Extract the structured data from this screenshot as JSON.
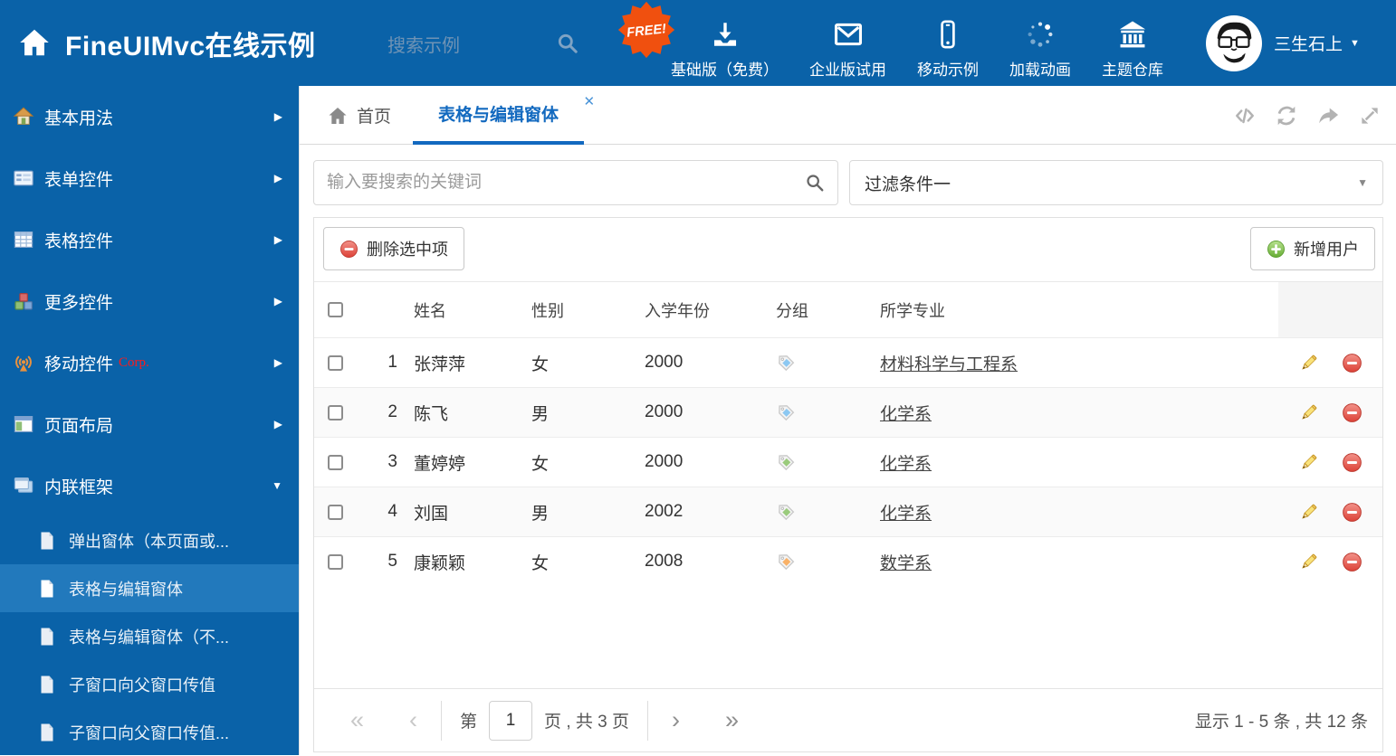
{
  "colors": {
    "header_bg": "#0A62A8",
    "sidebar_selected_bg": "#2279BC",
    "accent_blue": "#1269BF",
    "free_badge_bg": "#F0500F",
    "link_color": "#444444",
    "delete_red": "#DD4238",
    "add_green": "#66AC34",
    "pencil_yellow": "#F9E27A"
  },
  "icons": {
    "caret_down": "▼",
    "arrow_right": "▶",
    "arrow_down": "▼",
    "close": "✕",
    "chevron_double_left": "«",
    "chevron_left": "‹",
    "chevron_right": "›",
    "chevron_double_right": "»"
  },
  "header": {
    "title": "FineUIMvc在线示例",
    "search_placeholder": "搜索示例",
    "free_badge": "FREE!",
    "menu": [
      {
        "label": "基础版（免费）",
        "icon": "download-icon"
      },
      {
        "label": "企业版试用",
        "icon": "envelope-icon"
      },
      {
        "label": "移动示例",
        "icon": "mobile-icon"
      },
      {
        "label": "加载动画",
        "icon": "spinner-icon"
      },
      {
        "label": "主题仓库",
        "icon": "bank-icon"
      }
    ],
    "user_name": "三生石上"
  },
  "sidebar": {
    "items": [
      {
        "label": "基本用法",
        "icon": "home-icon"
      },
      {
        "label": "表单控件",
        "icon": "form-icon"
      },
      {
        "label": "表格控件",
        "icon": "grid-icon"
      },
      {
        "label": "更多控件",
        "icon": "cubes-icon"
      },
      {
        "label": "移动控件",
        "badge": "Corp.",
        "icon": "antenna-icon"
      },
      {
        "label": "页面布局",
        "icon": "layout-icon"
      },
      {
        "label": "内联框架",
        "icon": "frames-icon",
        "expanded": true
      }
    ],
    "subitems": [
      {
        "label": "弹出窗体（本页面或..."
      },
      {
        "label": "表格与编辑窗体",
        "selected": true
      },
      {
        "label": "表格与编辑窗体（不..."
      },
      {
        "label": "子窗口向父窗口传值"
      },
      {
        "label": "子窗口向父窗口传值..."
      }
    ]
  },
  "tabs": {
    "home": "首页",
    "active": "表格与编辑窗体"
  },
  "content": {
    "search_placeholder": "输入要搜索的关键词",
    "filter_value": "过滤条件一",
    "delete_button": "删除选中项",
    "add_button": "新增用户",
    "table": {
      "columns": [
        "姓名",
        "性别",
        "入学年份",
        "分组",
        "所学专业"
      ],
      "rows": [
        {
          "index": "1",
          "name": "张萍萍",
          "gender": "女",
          "year": "2000",
          "tag_color": "#8CC8F2",
          "major": "材料科学与工程系"
        },
        {
          "index": "2",
          "name": "陈飞",
          "gender": "男",
          "year": "2000",
          "tag_color": "#8CC8F2",
          "major": "化学系"
        },
        {
          "index": "3",
          "name": "董婷婷",
          "gender": "女",
          "year": "2000",
          "tag_color": "#9ACB7C",
          "major": "化学系"
        },
        {
          "index": "4",
          "name": "刘国",
          "gender": "男",
          "year": "2002",
          "tag_color": "#9ACB7C",
          "major": "化学系"
        },
        {
          "index": "5",
          "name": "康颖颖",
          "gender": "女",
          "year": "2008",
          "tag_color": "#F9B167",
          "major": "数学系"
        }
      ]
    },
    "pagination": {
      "prefix": "第",
      "page_value": "1",
      "suffix": "页 , 共 3 页",
      "summary": "显示 1 - 5 条 , 共 12 条"
    }
  }
}
